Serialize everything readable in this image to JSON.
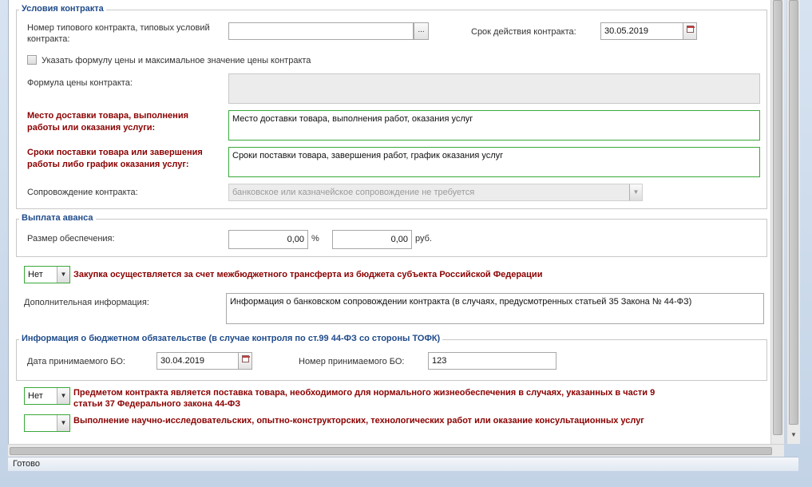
{
  "contract_conditions": {
    "legend": "Условия контракта",
    "typical_contract_label": "Номер типового контракта, типовых условий контракта:",
    "typical_contract_value": "",
    "browse_label": "...",
    "term_label": "Срок действия контракта:",
    "term_value": "30.05.2019",
    "formula_checkbox_label": "Указать формулу цены и максимальное значение цены контракта",
    "formula_label": "Формула цены контракта:",
    "formula_value": "",
    "delivery_place_label": "Место доставки товара, выполнения работы или оказания услуги:",
    "delivery_place_value": "Место доставки товара, выполнения работ, оказания услуг",
    "delivery_terms_label": "Сроки поставки товара или завершения работы либо график оказания услуг:",
    "delivery_terms_value": "Сроки поставки товара, завершения работ, график оказания услуг",
    "support_label": "Сопровождение контракта:",
    "support_value": "банковское или казначейское сопровождение не требуется"
  },
  "advance": {
    "legend": "Выплата аванса",
    "security_label": "Размер обеспечения:",
    "percent_value": "0,00",
    "percent_unit": "%",
    "rub_value": "0,00",
    "rub_unit": "руб."
  },
  "interbudget": {
    "value": "Нет",
    "label": "Закупка осуществляется за счет межбюджетного трансферта из бюджета субъекта Российской Федерации"
  },
  "additional_info": {
    "label": "Дополнительная информация:",
    "value": "Информация о банковском сопровождении контракта (в случаях, предусмотренных статьей 35 Закона № 44-ФЗ)"
  },
  "budget_obligation": {
    "legend": "Информация о бюджетном обязательстве (в случае контроля по ст.99 44-ФЗ со стороны ТОФК)",
    "date_label": "Дата принимаемого БО:",
    "date_value": "30.04.2019",
    "number_label": "Номер принимаемого БО:",
    "number_value": "123"
  },
  "life_support": {
    "value": "Нет",
    "label_line1": "Предметом контракта является поставка товара, необходимого для нормального жизнеобеспечения в случаях, указанных в части 9",
    "label_line2": "статьи 37 Федерального закона 44-ФЗ"
  },
  "research": {
    "value": "",
    "label": "Выполнение научно-исследовательских, опытно-конструкторских, технологических работ или оказание консультационных услуг"
  },
  "status": {
    "text": "Готово"
  },
  "icons": {
    "calendar": "calendar-icon",
    "dropdown": "chevron-down-icon"
  }
}
